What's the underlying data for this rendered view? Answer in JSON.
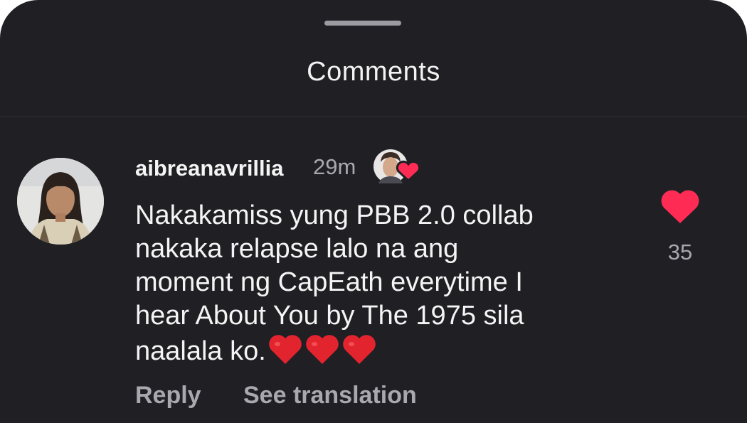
{
  "sheet": {
    "title": "Comments"
  },
  "comment": {
    "username": "aibreanavrillia",
    "timestamp": "29m",
    "text": "Nakakamiss yung PBB 2.0 collab\nnakaka relapse lalo na ang\nmoment ng CapEath everytime I\nhear About You by The 1975 sila\nnaalala ko.",
    "emoji": [
      "red-heart",
      "red-heart",
      "red-heart"
    ],
    "like_count": "35",
    "creator_liked": true
  },
  "actions": {
    "reply_label": "Reply",
    "translate_label": "See translation"
  },
  "colors": {
    "background": "#1f1f24",
    "text_primary": "#f4f4f4",
    "text_secondary": "#a8a8ae",
    "heart": "#fe2c55"
  },
  "icons": {
    "like": "heart-icon",
    "creator_badge": "creator-heart-icon"
  }
}
